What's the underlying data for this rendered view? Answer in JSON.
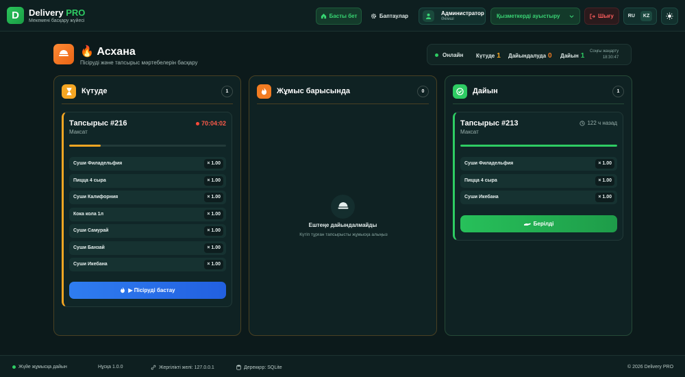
{
  "header": {
    "logo_letter": "D",
    "brand": "Delivery",
    "brand_pro": "PRO",
    "subtitle": "Мекемені басқару жүйесі",
    "home_label": "Басты бет",
    "settings_label": "Баптаулар",
    "user_name": "Администратор",
    "user_role": "Әкімші",
    "switch_label": "Қызметкерді ауыстыру",
    "logout_label": "Шығу",
    "lang_ru": "RU",
    "lang_kz": "KZ"
  },
  "page": {
    "title": "Асхана",
    "subtitle": "Пісіруді және тапсырыс мәртебелерін басқару"
  },
  "status": {
    "online": "Онлайн",
    "waiting_label": "Күтуде",
    "waiting_count": "1",
    "cooking_label": "Дайындалуда",
    "cooking_count": "0",
    "ready_label": "Дайын",
    "ready_count": "1",
    "update_label": "Соңғы жаңарту",
    "update_time": "18:30:47"
  },
  "columns": {
    "waiting": {
      "title": "Күтуде",
      "count": "1",
      "order": {
        "title": "Тапсырыс #216",
        "customer": "Максат",
        "timer": "70:04:02",
        "progress": 0.2,
        "items": [
          {
            "name": "Суши Филадельфия",
            "qty": "× 1.00"
          },
          {
            "name": "Пицца 4 сыра",
            "qty": "× 1.00"
          },
          {
            "name": "Суши Калифорния",
            "qty": "× 1.00"
          },
          {
            "name": "Кока кола 1л",
            "qty": "× 1.00"
          },
          {
            "name": "Суши Самурай",
            "qty": "× 1.00"
          },
          {
            "name": "Суши Банзай",
            "qty": "× 1.00"
          },
          {
            "name": "Суши Икебана",
            "qty": "× 1.00"
          }
        ],
        "button": "▶ Пісіруді бастау"
      }
    },
    "cooking": {
      "title": "Жұмыс барысында",
      "count": "0",
      "empty_title": "Ештеңе дайындалмайды",
      "empty_sub": "Күтіп тұрған тапсырысты жұмысқа алыңыз"
    },
    "ready": {
      "title": "Дайын",
      "count": "1",
      "order": {
        "title": "Тапсырыс #213",
        "customer": "Максат",
        "ago": "122 ч назад",
        "progress": 1.0,
        "items": [
          {
            "name": "Суши Филадельфия",
            "qty": "× 1.00"
          },
          {
            "name": "Пицца 4 сыра",
            "qty": "× 1.00"
          },
          {
            "name": "Суши Икебана",
            "qty": "× 1.00"
          }
        ],
        "button": "Берілді"
      }
    }
  },
  "footer": {
    "system": "Жүйе жұмысқа дайын",
    "version": "Нұсқа 1.0.0",
    "network": "Жергілікті желі: 127.0.0.1",
    "database": "Дерекқор: SQLite",
    "copyright": "© 2026 Delivery PRO"
  },
  "colors": {
    "accent_green": "#2ecc63",
    "accent_orange": "#f5a623",
    "accent_blue": "#2f7df0",
    "danger": "#ff5a4a"
  }
}
